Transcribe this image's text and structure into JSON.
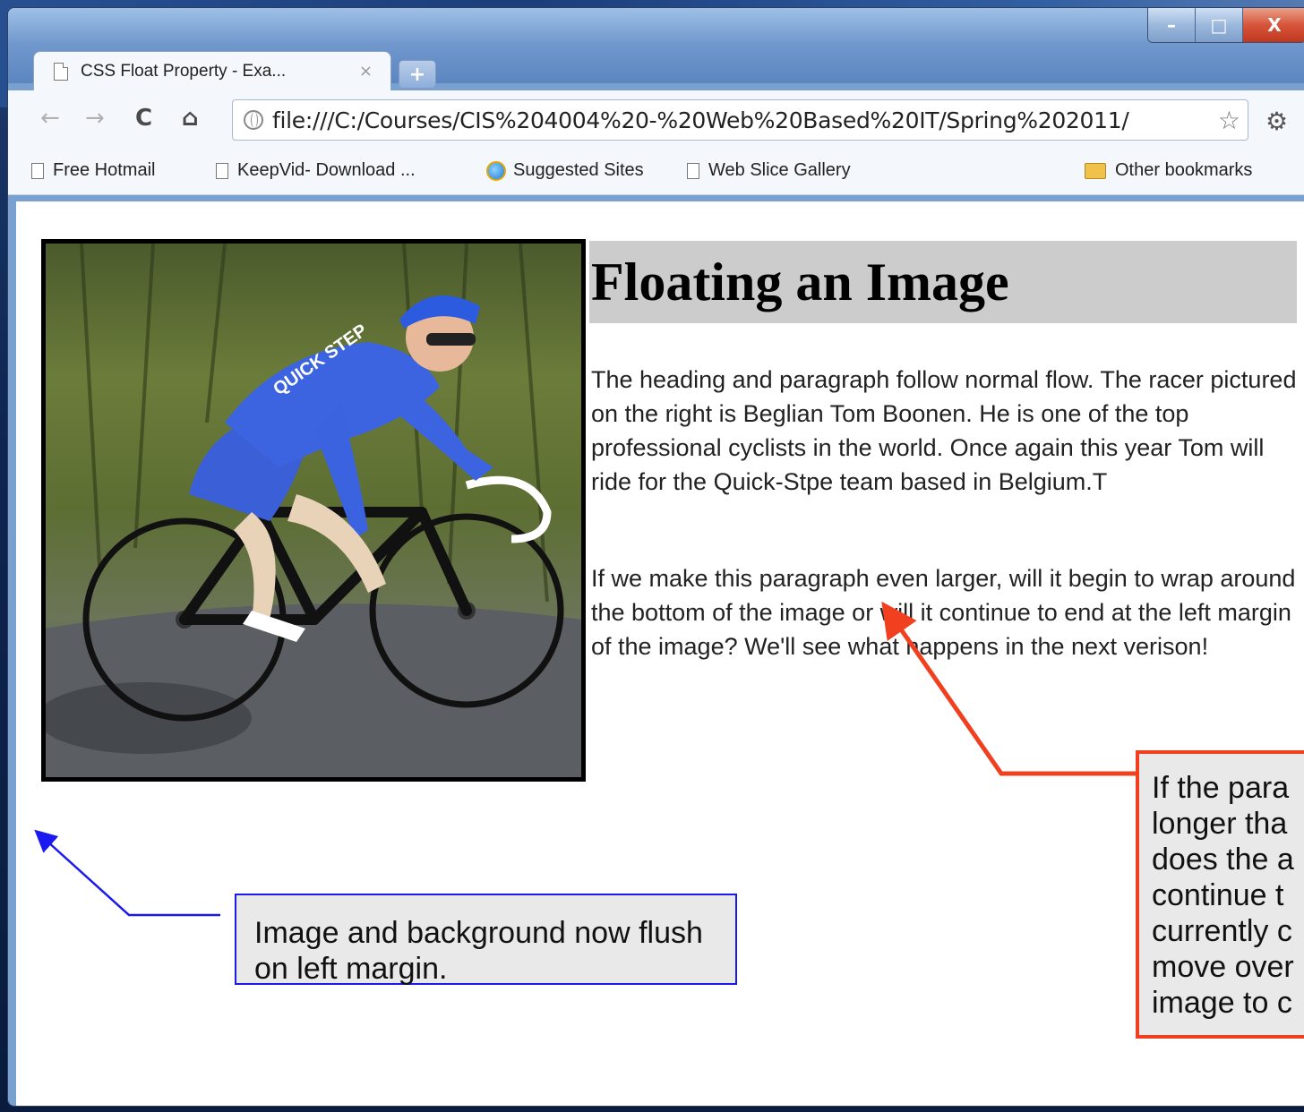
{
  "browser": {
    "window_controls": {
      "minimize": "–",
      "maximize": "□",
      "close": "X"
    },
    "tab": {
      "title": "CSS Float Property - Exa...",
      "close": "×"
    },
    "new_tab": "+",
    "nav": {
      "back": "←",
      "forward": "→",
      "reload": "C",
      "home": "⌂"
    },
    "url": "file:///C:/Courses/CIS%204004%20-%20Web%20Based%20IT/Spring%202011/",
    "star": "☆",
    "wrench": "🔧",
    "bookmarks": [
      "Free Hotmail",
      "KeepVid- Download ...",
      "Suggested Sites",
      "Web Slice Gallery"
    ],
    "other_bookmarks": "Other bookmarks"
  },
  "page": {
    "heading": "Floating an Image",
    "paragraph1": "The heading and paragraph follow normal flow. The racer pictured on the right is Beglian Tom Boonen. He is one of the top professional cyclists in the world. Once again this year Tom will ride for the Quick-Stpe team based in Belgium.T",
    "paragraph2": "If we make this paragraph even larger, will it begin to wrap around the bottom of the image or will it continue to end at the left margin of the image? We'll see what happens in the next verison!",
    "photo_jersey_text": "QUICK STEP"
  },
  "annotations": {
    "blue_note": "Image and background now flush on left margin.",
    "red_note_lines": [
      "If the para",
      "longer tha",
      "does the a",
      "continue t",
      "currently c",
      "move over",
      "image to c"
    ],
    "colors": {
      "blue": "#1a1af0",
      "red": "#f04020"
    }
  }
}
